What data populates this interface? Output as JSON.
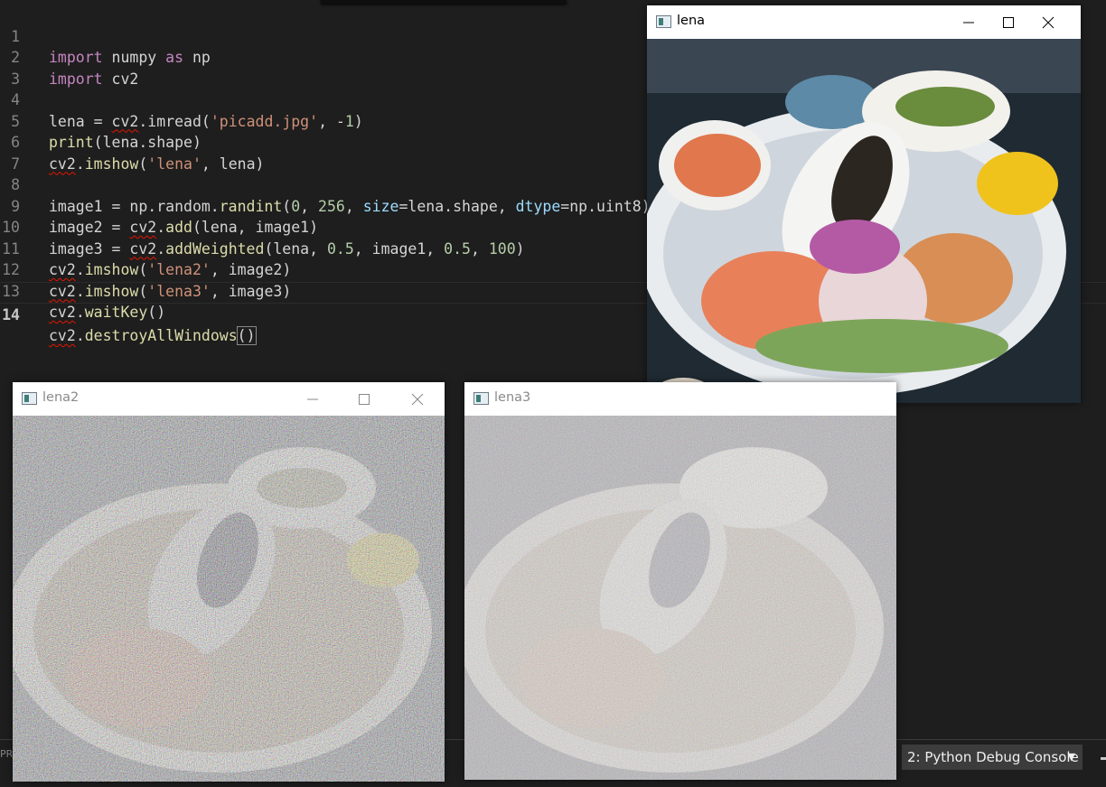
{
  "editor": {
    "lines": [
      {
        "n": "1"
      },
      {
        "n": "2"
      },
      {
        "n": "3"
      },
      {
        "n": "4"
      },
      {
        "n": "5"
      },
      {
        "n": "6"
      },
      {
        "n": "7"
      },
      {
        "n": "8"
      },
      {
        "n": "9"
      },
      {
        "n": "10"
      },
      {
        "n": "11"
      },
      {
        "n": "12"
      },
      {
        "n": "13"
      },
      {
        "n": "14"
      }
    ],
    "code": {
      "l1": [
        "import",
        " numpy ",
        "as",
        " np"
      ],
      "l2": [
        "import",
        " cv2"
      ],
      "l4": [
        "lena = ",
        "cv2",
        ".imread(",
        "'picadd.jpg'",
        ", -",
        "1",
        ")"
      ],
      "l5": [
        "print",
        "(lena.shape)"
      ],
      "l6": [
        "cv2",
        ".",
        "imshow",
        "(",
        "'lena'",
        ", lena)"
      ],
      "l8": [
        "image1 = np.random.",
        "randint",
        "(",
        "0",
        ", ",
        "256",
        ", ",
        "size",
        "=lena.shape, ",
        "dtype",
        "=np.uint8)"
      ],
      "l9": [
        "image2 = ",
        "cv2",
        ".",
        "add",
        "(lena, image1)"
      ],
      "l10": [
        "image3 = ",
        "cv2",
        ".",
        "addWeighted",
        "(lena, ",
        "0.5",
        ", image1, ",
        "0.5",
        ", ",
        "100",
        ")"
      ],
      "l11": [
        "cv2",
        ".",
        "imshow",
        "(",
        "'lena2'",
        ", image2)"
      ],
      "l12": [
        "cv2",
        ".",
        "imshow",
        "(",
        "'lena3'",
        ", image3)"
      ],
      "l13": [
        "cv2",
        ".",
        "waitKey",
        "()"
      ],
      "l14": [
        "cv2",
        ".",
        "destroyAllWindows",
        "()"
      ]
    },
    "active_line": "14"
  },
  "windows": {
    "lena": {
      "title": "lena"
    },
    "lena2": {
      "title": "lena2"
    },
    "lena3": {
      "title": "lena3"
    }
  },
  "panel": {
    "left_text": "PRO",
    "terminal_selector": "2: Python Debug Console",
    "caret": "▼"
  },
  "icons": [
    "app-icon",
    "minimize-icon",
    "maximize-icon",
    "close-icon",
    "chevron-down-icon"
  ],
  "colors": {
    "editor_bg": "#1e1e1e",
    "keyword": "#c586c0",
    "function": "#dcdcaa",
    "string": "#ce9178",
    "number": "#b5cea8",
    "parameter": "#9cdcfe",
    "squiggle": "#e51400"
  }
}
